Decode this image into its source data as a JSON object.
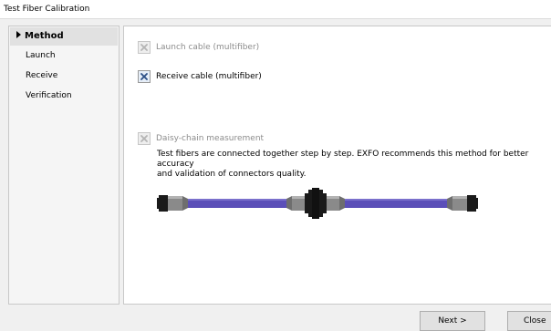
{
  "window": {
    "title": "Test Fiber Calibration"
  },
  "sidebar": {
    "items": [
      {
        "label": "Method",
        "active": true
      },
      {
        "label": "Launch",
        "active": false
      },
      {
        "label": "Receive",
        "active": false
      },
      {
        "label": "Verification",
        "active": false
      }
    ]
  },
  "main": {
    "options": [
      {
        "label": "Launch cable (multifiber)",
        "checked": true,
        "enabled": false
      },
      {
        "label": "Receive cable (multifiber)",
        "checked": true,
        "enabled": true
      },
      {
        "label": "Daisy-chain measurement",
        "checked": true,
        "enabled": false
      }
    ],
    "description_line1": "Test fibers are connected together step by step. EXFO recommends this method for better accuracy",
    "description_line2": "and validation of connectors quality.",
    "cable_color": "#5b4fb8"
  },
  "footer": {
    "next_label": "Next >",
    "close_label": "Close"
  }
}
